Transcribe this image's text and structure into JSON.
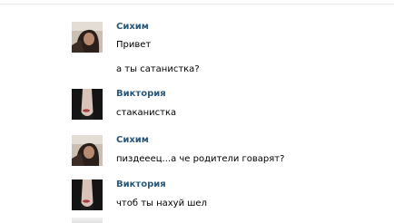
{
  "colors": {
    "author": "#2b587a",
    "text": "#000000",
    "background": "#ffffff"
  },
  "messages": [
    {
      "author": "Сихим",
      "avatar_icon": "user-photo-sikhim",
      "lines": [
        "Привет",
        "а ты сатанистка?"
      ]
    },
    {
      "author": "Виктория",
      "avatar_icon": "user-photo-viktoria",
      "lines": [
        "стаканистка"
      ]
    },
    {
      "author": "Сихим",
      "avatar_icon": "user-photo-sikhim",
      "lines": [
        "пиздееец...а че родители говарят?"
      ]
    },
    {
      "author": "Виктория",
      "avatar_icon": "user-photo-viktoria",
      "lines": [
        "чтоб ты нахуй шел"
      ]
    }
  ]
}
